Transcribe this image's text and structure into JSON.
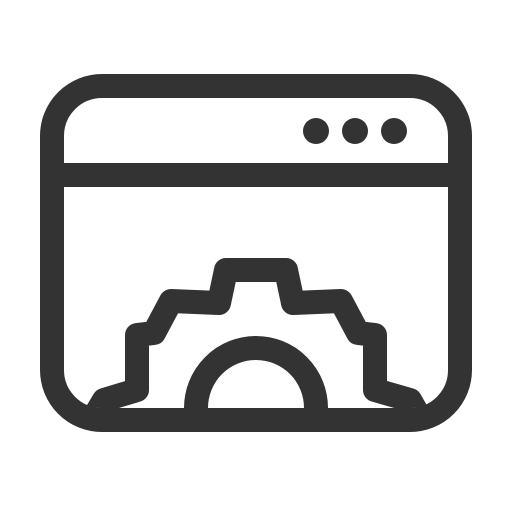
{
  "icon": {
    "name": "browser-settings-icon",
    "stroke_color": "#333333",
    "background_color": "#ffffff",
    "parts": {
      "window": "browser-window-icon",
      "dots": "window-dots-icon",
      "gear": "gear-icon"
    }
  }
}
